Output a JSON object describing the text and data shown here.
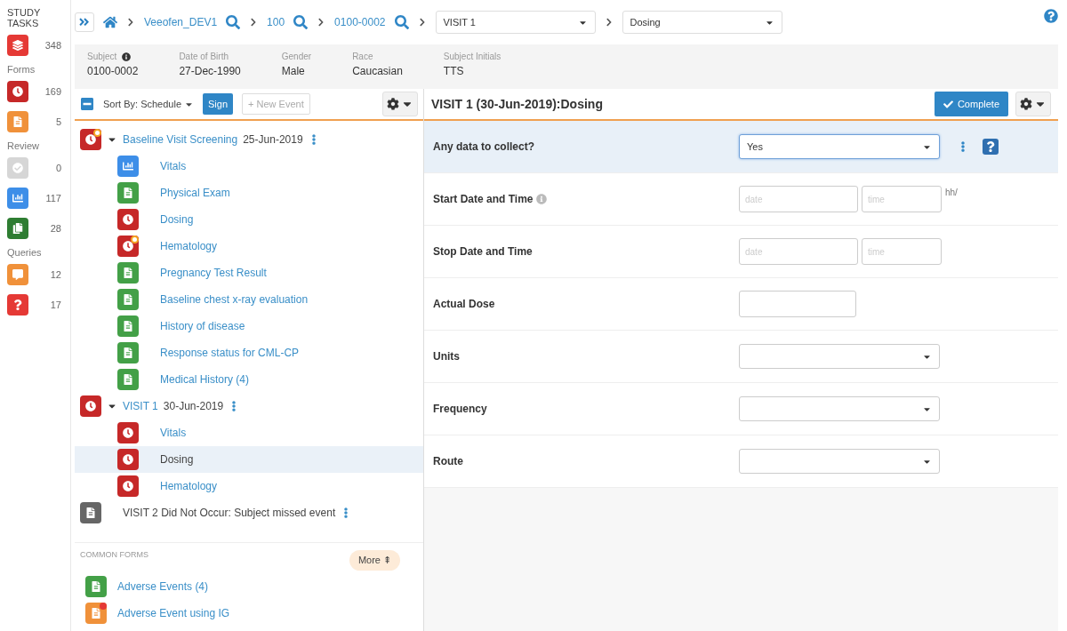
{
  "sidebar": {
    "title": "STUDY TASKS",
    "sections": [
      {
        "items": [
          {
            "kind": "stack",
            "count": "348"
          }
        ]
      },
      {
        "label": "Forms",
        "items": [
          {
            "kind": "clock",
            "count": "169"
          },
          {
            "kind": "doc-orange",
            "count": "5"
          }
        ]
      },
      {
        "label": "Review",
        "items": [
          {
            "kind": "check",
            "count": "0"
          },
          {
            "kind": "chart",
            "count": "117"
          },
          {
            "kind": "copy",
            "count": "28"
          }
        ]
      },
      {
        "label": "Queries",
        "items": [
          {
            "kind": "chat",
            "count": "12"
          },
          {
            "kind": "question",
            "count": "17"
          }
        ]
      }
    ]
  },
  "breadcrumb": {
    "links": [
      "Veeofen_DEV1",
      "100",
      "0100-0002"
    ],
    "selects": [
      "VISIT 1",
      "Dosing"
    ]
  },
  "subject": [
    {
      "label": "Subject",
      "value": "0100-0002"
    },
    {
      "label": "Date of Birth",
      "value": "27-Dec-1990"
    },
    {
      "label": "Gender",
      "value": "Male"
    },
    {
      "label": "Race",
      "value": "Caucasian"
    },
    {
      "label": "Subject Initials",
      "value": "TTS"
    }
  ],
  "toolbar": {
    "sort_label": "Sort By:",
    "sort_value": "Schedule",
    "sign": "Sign",
    "new_event": "+ New Event"
  },
  "events": [
    {
      "kind": "clock",
      "title": "Baseline Visit Screening",
      "date": "25-Jun-2019",
      "expanded": true,
      "flag": true,
      "children": [
        {
          "kind": "chart",
          "name": "Vitals",
          "selected": false,
          "flag": false
        },
        {
          "kind": "doc",
          "name": "Physical Exam",
          "selected": false,
          "flag": false
        },
        {
          "kind": "clock",
          "name": "Dosing",
          "selected": false,
          "flag": false
        },
        {
          "kind": "clock",
          "name": "Hematology",
          "selected": false,
          "flag": true
        },
        {
          "kind": "doc",
          "name": "Pregnancy Test Result",
          "selected": false,
          "flag": false
        },
        {
          "kind": "doc",
          "name": "Baseline chest x-ray evaluation",
          "selected": false,
          "flag": false
        },
        {
          "kind": "doc",
          "name": "History of disease",
          "selected": false,
          "flag": false
        },
        {
          "kind": "doc",
          "name": "Response status for CML-CP",
          "selected": false,
          "flag": false
        },
        {
          "kind": "doc",
          "name": "Medical History (4)",
          "selected": false,
          "flag": false
        }
      ]
    },
    {
      "kind": "clock",
      "title": "VISIT 1",
      "date": "30-Jun-2019",
      "expanded": true,
      "flag": false,
      "children": [
        {
          "kind": "clock",
          "name": "Vitals",
          "selected": false,
          "flag": false
        },
        {
          "kind": "clock",
          "name": "Dosing",
          "selected": true,
          "flag": false
        },
        {
          "kind": "clock",
          "name": "Hematology",
          "selected": false,
          "flag": false
        }
      ]
    },
    {
      "kind": "missed",
      "title": "VISIT 2 Did Not Occur: Subject missed event",
      "flag": false
    }
  ],
  "common_forms": {
    "title": "COMMON FORMS",
    "more": "More ⇞",
    "items": [
      {
        "kind": "doc",
        "name": "Adverse Events (4)",
        "flag": false
      },
      {
        "kind": "doc-orange",
        "name": "Adverse Event using IG",
        "flag": true
      }
    ]
  },
  "form": {
    "title": "VISIT 1 (30-Jun-2019):Dosing",
    "complete": "Complete",
    "fields": [
      {
        "kind": "select",
        "label": "Any data to collect?",
        "value": "Yes",
        "selected": true,
        "info": false
      },
      {
        "kind": "datetime",
        "label": "Start Date and Time",
        "date_placeholder": "date",
        "time_placeholder": "time",
        "suffix": "hh/",
        "selected": false,
        "info": true
      },
      {
        "kind": "datetime",
        "label": "Stop Date and Time",
        "date_placeholder": "date",
        "time_placeholder": "time",
        "selected": false,
        "info": false
      },
      {
        "kind": "text",
        "label": "Actual Dose",
        "selected": false,
        "info": false
      },
      {
        "kind": "select",
        "label": "Units",
        "selected": false,
        "info": false
      },
      {
        "kind": "select",
        "label": "Frequency",
        "selected": false,
        "info": false
      },
      {
        "kind": "select",
        "label": "Route",
        "selected": false,
        "info": false
      }
    ]
  }
}
